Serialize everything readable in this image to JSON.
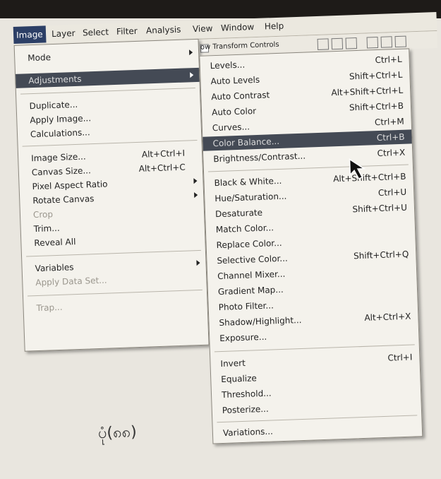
{
  "menubar": [
    "Image",
    "Layer",
    "Select",
    "Filter",
    "Analysis",
    "View",
    "Window",
    "Help"
  ],
  "options_bar": {
    "label": "ow Transform Controls"
  },
  "image_menu": {
    "items": [
      {
        "label": "Mode",
        "submenu": true
      },
      {
        "label": "Adjustments",
        "submenu": true,
        "highlighted": true
      },
      {
        "label": "Duplicate..."
      },
      {
        "label": "Apply Image..."
      },
      {
        "label": "Calculations..."
      },
      {
        "label": "Image Size...",
        "shortcut": "Alt+Ctrl+I"
      },
      {
        "label": "Canvas Size...",
        "shortcut": "Alt+Ctrl+C"
      },
      {
        "label": "Pixel Aspect Ratio",
        "submenu": true
      },
      {
        "label": "Rotate Canvas",
        "submenu": true
      },
      {
        "label": "Crop",
        "disabled": true
      },
      {
        "label": "Trim..."
      },
      {
        "label": "Reveal All"
      },
      {
        "label": "Variables",
        "submenu": true
      },
      {
        "label": "Apply Data Set...",
        "disabled": true
      },
      {
        "label": "Trap...",
        "disabled": true
      }
    ]
  },
  "adjustments_menu": {
    "items": [
      {
        "label": "Levels...",
        "shortcut": "Ctrl+L"
      },
      {
        "label": "Auto Levels",
        "shortcut": "Shift+Ctrl+L"
      },
      {
        "label": "Auto Contrast",
        "shortcut": "Alt+Shift+Ctrl+L"
      },
      {
        "label": "Auto Color",
        "shortcut": "Shift+Ctrl+B"
      },
      {
        "label": "Curves...",
        "shortcut": "Ctrl+M"
      },
      {
        "label": "Color Balance...",
        "shortcut": "Ctrl+B",
        "highlighted": true
      },
      {
        "label": "Brightness/Contrast...",
        "shortcut": "Ctrl+X"
      },
      {
        "label": "Black & White...",
        "shortcut": "Alt+Shift+Ctrl+B"
      },
      {
        "label": "Hue/Saturation...",
        "shortcut": "Ctrl+U"
      },
      {
        "label": "Desaturate",
        "shortcut": "Shift+Ctrl+U"
      },
      {
        "label": "Match Color..."
      },
      {
        "label": "Replace Color..."
      },
      {
        "label": "Selective Color...",
        "shortcut": "Shift+Ctrl+Q"
      },
      {
        "label": "Channel Mixer..."
      },
      {
        "label": "Gradient Map..."
      },
      {
        "label": "Photo Filter..."
      },
      {
        "label": "Shadow/Highlight...",
        "shortcut": "Alt+Ctrl+X"
      },
      {
        "label": "Exposure..."
      },
      {
        "label": "Invert",
        "shortcut": "Ctrl+I"
      },
      {
        "label": "Equalize"
      },
      {
        "label": "Threshold..."
      },
      {
        "label": "Posterize..."
      },
      {
        "label": "Variations..."
      }
    ]
  },
  "caption": "ပုံ(၈၈)"
}
